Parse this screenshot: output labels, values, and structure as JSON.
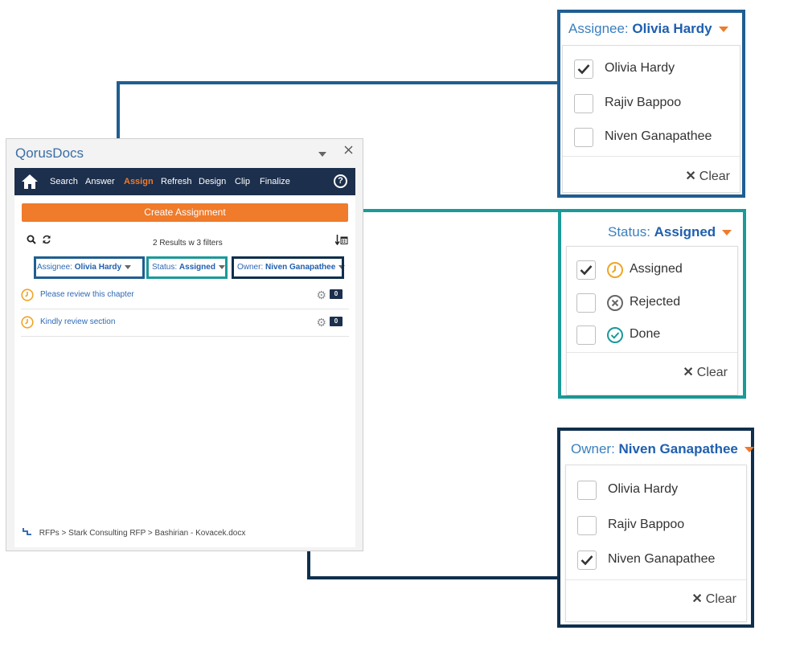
{
  "app": {
    "title": "QorusDocs"
  },
  "titlebar": {
    "menu_icon": "caret-down-icon",
    "close_icon": "close-icon"
  },
  "nav": {
    "items": [
      {
        "label": "Search"
      },
      {
        "label": "Answer"
      },
      {
        "label": "Assign",
        "active": true
      },
      {
        "label": "Refresh"
      },
      {
        "label": "Design"
      },
      {
        "label": "Clip"
      },
      {
        "label": "Finalize"
      }
    ],
    "help_label": "?"
  },
  "toolbar": {
    "create_label": "Create Assignment",
    "results_text": "2 Results w 3 filters"
  },
  "filters": {
    "assignee": {
      "prefix": "Assignee:",
      "value": "Olivia Hardy"
    },
    "status": {
      "prefix": "Status:",
      "value": "Assigned"
    },
    "owner": {
      "prefix": "Owner:",
      "value": "Niven Ganapathee"
    }
  },
  "tasks": [
    {
      "label": "Please review this chapter",
      "count": "0",
      "status_icon": "clock-icon"
    },
    {
      "label": "Kindly review section",
      "count": "0",
      "status_icon": "clock-icon"
    }
  ],
  "breadcrumb": "RFPs > Stark Consulting RFP > Bashirian - Kovacek.docx",
  "assignee_dropdown": {
    "prefix": "Assignee:",
    "value": "Olivia Hardy",
    "options": [
      {
        "label": "Olivia Hardy",
        "checked": true
      },
      {
        "label": "Rajiv Bappoo",
        "checked": false
      },
      {
        "label": "Niven Ganapathee",
        "checked": false
      }
    ],
    "clear_label": "Clear"
  },
  "status_dropdown": {
    "prefix": "Status:",
    "value": "Assigned",
    "options": [
      {
        "label": "Assigned",
        "checked": true,
        "icon": "clock-icon"
      },
      {
        "label": "Rejected",
        "checked": false,
        "icon": "x-circle-icon"
      },
      {
        "label": "Done",
        "checked": false,
        "icon": "check-circle-icon"
      }
    ],
    "clear_label": "Clear"
  },
  "owner_dropdown": {
    "prefix": "Owner:",
    "value": "Niven Ganapathee",
    "options": [
      {
        "label": "Olivia Hardy",
        "checked": false
      },
      {
        "label": "Rajiv Bappoo",
        "checked": false
      },
      {
        "label": "Niven Ganapathee",
        "checked": true
      }
    ],
    "clear_label": "Clear"
  },
  "colors": {
    "assignee_frame": "#1f5e92",
    "status_frame": "#1a9a99",
    "owner_frame": "#0f2f4d",
    "accent_orange": "#ef7b2b",
    "nav_bg": "#1c2f4c"
  }
}
